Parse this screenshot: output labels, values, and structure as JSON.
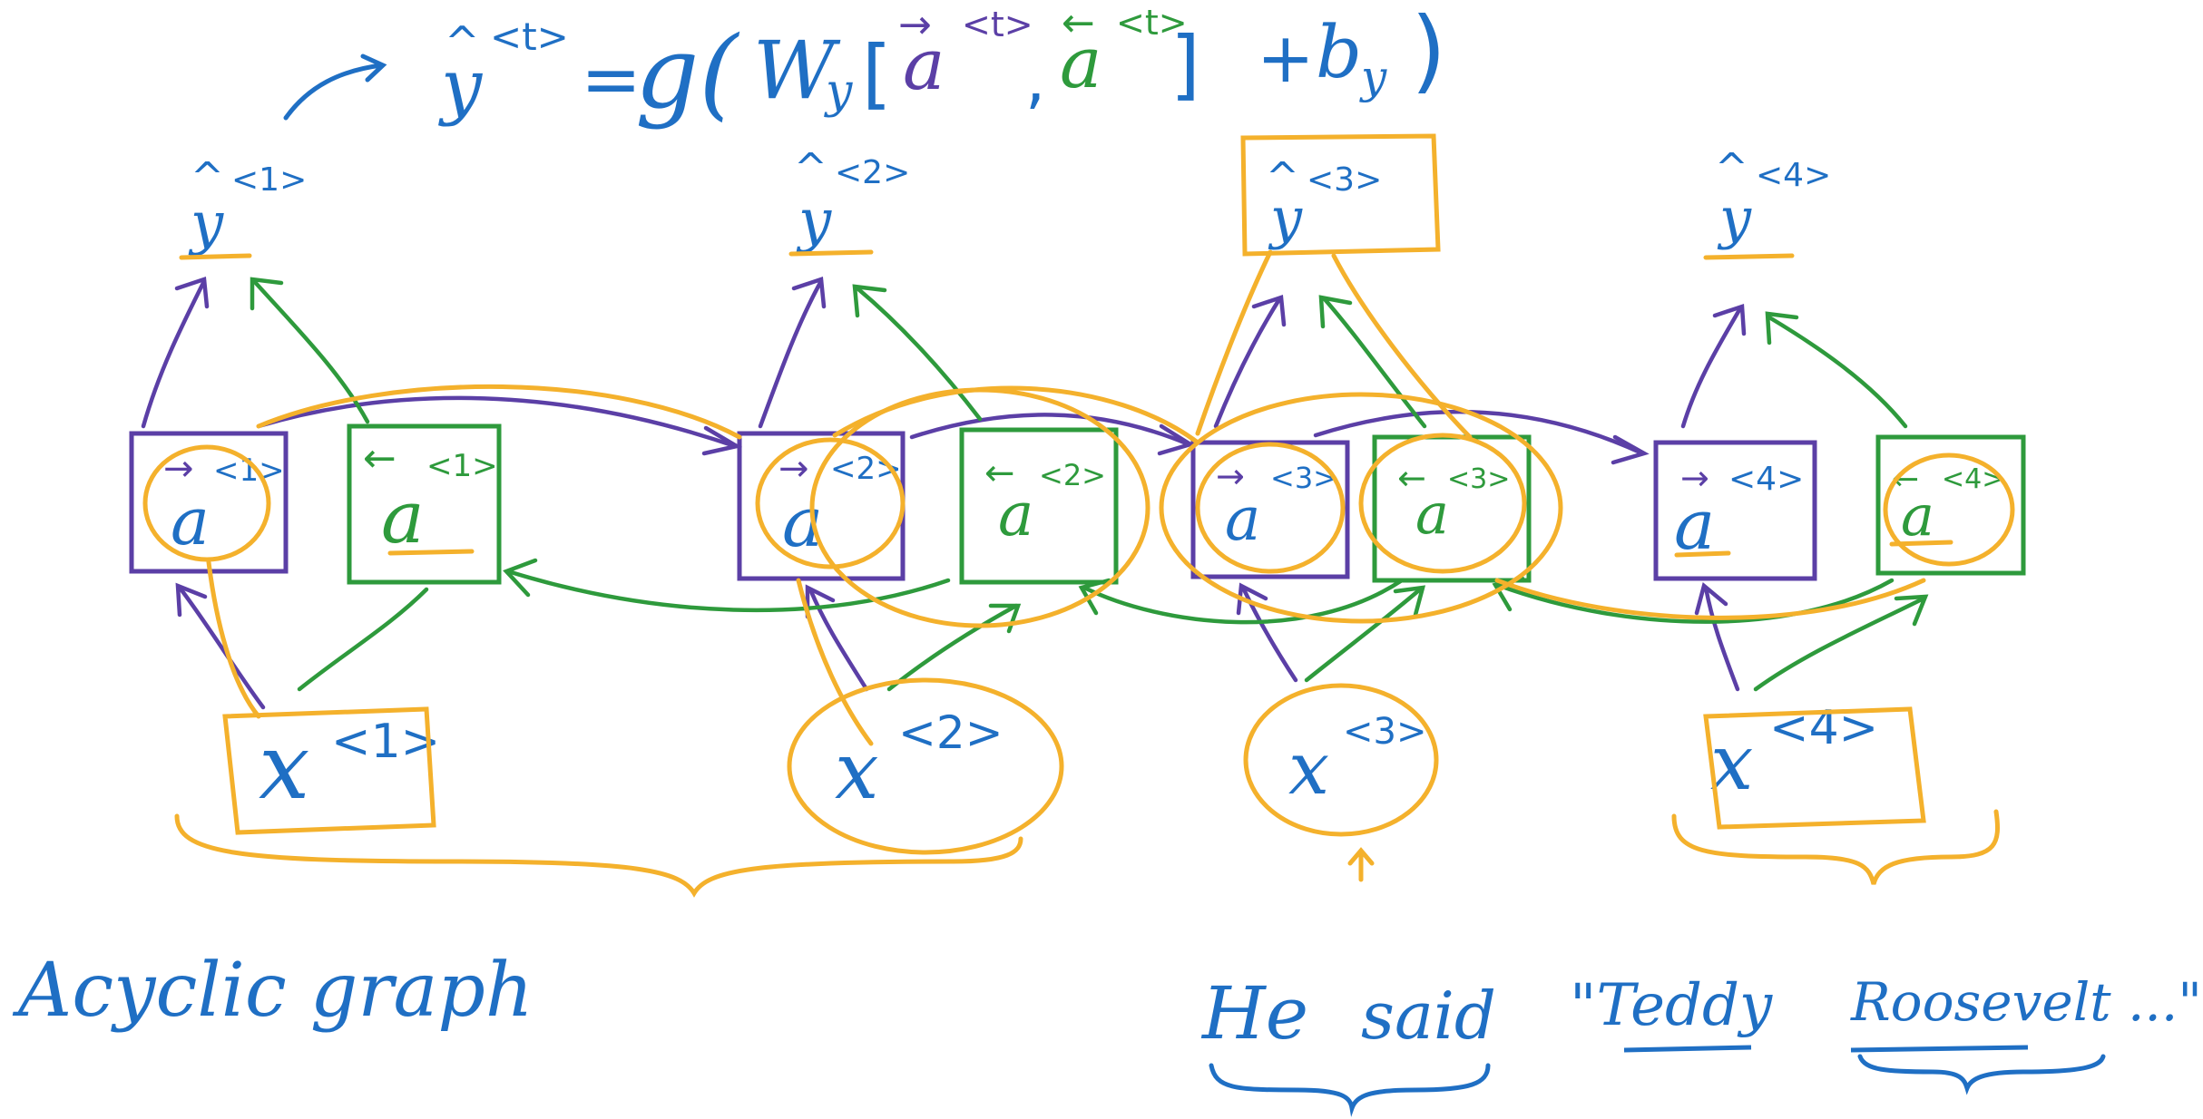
{
  "formula": {
    "lhs": "y",
    "lhs_hat": "^",
    "lhs_sup": "<t>",
    "eq": "=",
    "func": "g(",
    "weight": "W",
    "weight_sub": "y",
    "open_bracket": "[",
    "fwd": "a",
    "fwd_arrow": "→",
    "fwd_sup": "<t>",
    "comma": ",",
    "bwd": "a",
    "bwd_arrow": "←",
    "bwd_sup": "<t>",
    "close_bracket": "]",
    "plus": "+",
    "bias": "b",
    "bias_sub": "y",
    "close": ")"
  },
  "outputs": [
    {
      "hat": "^",
      "var": "y",
      "sup": "<1>"
    },
    {
      "hat": "^",
      "var": "y",
      "sup": "<2>"
    },
    {
      "hat": "^",
      "var": "y",
      "sup": "<3>"
    },
    {
      "hat": "^",
      "var": "y",
      "sup": "<4>"
    }
  ],
  "forward_units": [
    {
      "arrow": "→",
      "var": "a",
      "sup": "<1>"
    },
    {
      "arrow": "→",
      "var": "a",
      "sup": "<2>"
    },
    {
      "arrow": "→",
      "var": "a",
      "sup": "<3>"
    },
    {
      "arrow": "→",
      "var": "a",
      "sup": "<4>"
    }
  ],
  "backward_units": [
    {
      "arrow": "←",
      "var": "a",
      "sup": "<1>"
    },
    {
      "arrow": "←",
      "var": "a",
      "sup": "<2>"
    },
    {
      "arrow": "←",
      "var": "a",
      "sup": "<3>"
    },
    {
      "arrow": "←",
      "var": "a",
      "sup": "<4>"
    }
  ],
  "inputs": [
    {
      "var": "x",
      "sup": "<1>"
    },
    {
      "var": "x",
      "sup": "<2>"
    },
    {
      "var": "x",
      "sup": "<3>"
    },
    {
      "var": "x",
      "sup": "<4>"
    }
  ],
  "note_left": "Acyclic graph",
  "sentence": {
    "w1": "He",
    "w2": "said",
    "w3": "\"Teddy",
    "w4": "Roosevelt ...\""
  },
  "colors": {
    "blue": "#1f6fc4",
    "purple": "#5b3fa6",
    "green": "#2e9a3c",
    "orange": "#f4b12c"
  }
}
